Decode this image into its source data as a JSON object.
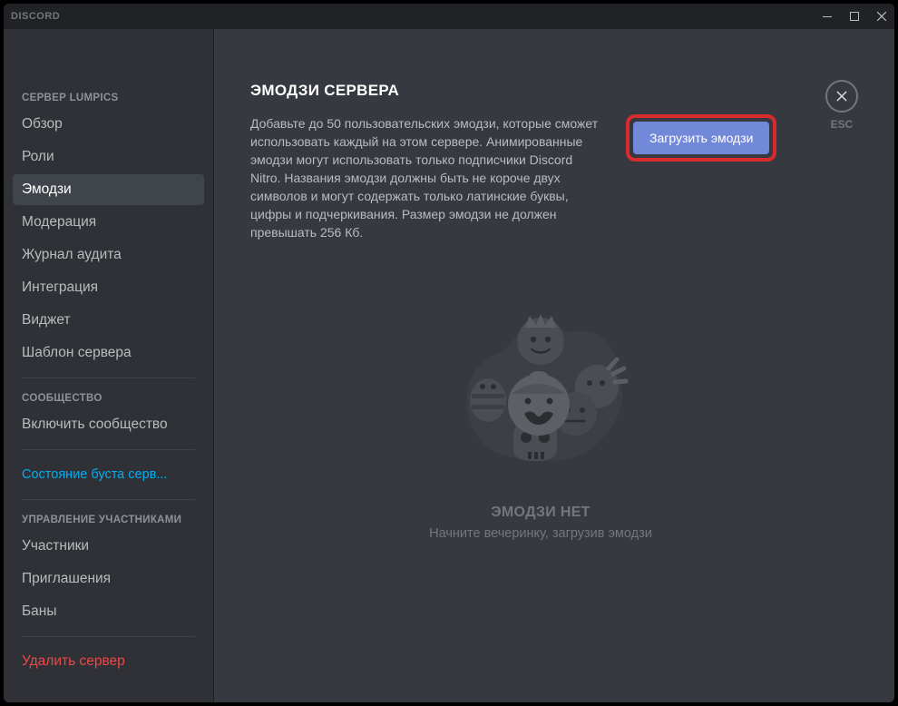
{
  "titlebar": {
    "app_name": "DISCORD"
  },
  "sidebar": {
    "section_server_label": "СЕРВЕР LUMPICS",
    "items_server": [
      {
        "label": "Обзор",
        "active": false
      },
      {
        "label": "Роли",
        "active": false
      },
      {
        "label": "Эмодзи",
        "active": true
      },
      {
        "label": "Модерация",
        "active": false
      },
      {
        "label": "Журнал аудита",
        "active": false
      },
      {
        "label": "Интеграция",
        "active": false
      },
      {
        "label": "Виджет",
        "active": false
      },
      {
        "label": "Шаблон сервера",
        "active": false
      }
    ],
    "section_community_label": "СООБЩЕСТВО",
    "items_community": [
      {
        "label": "Включить сообщество"
      }
    ],
    "boost_status_label": "Состояние буста серв...",
    "section_members_label": "УПРАВЛЕНИЕ УЧАСТНИКАМИ",
    "items_members": [
      {
        "label": "Участники"
      },
      {
        "label": "Приглашения"
      },
      {
        "label": "Баны"
      }
    ],
    "delete_server_label": "Удалить сервер"
  },
  "main": {
    "title": "ЭМОДЗИ СЕРВЕРА",
    "description": "Добавьте до 50 пользовательских эмодзи, которые сможет использовать каждый на этом сервере. Анимированные эмодзи могут использовать только подписчики Discord Nitro. Названия эмодзи должны быть не короче двух символов и могут содержать только латинские буквы, цифры и подчеркивания. Размер эмодзи не должен превышать 256 Кб.",
    "upload_button_label": "Загрузить эмодзи",
    "empty_title": "ЭМОДЗИ НЕТ",
    "empty_subtitle": "Начните вечеринку, загрузив эмодзи",
    "esc_label": "ESC"
  },
  "colors": {
    "accent": "#7289da",
    "highlight_border": "#d82b2b"
  }
}
